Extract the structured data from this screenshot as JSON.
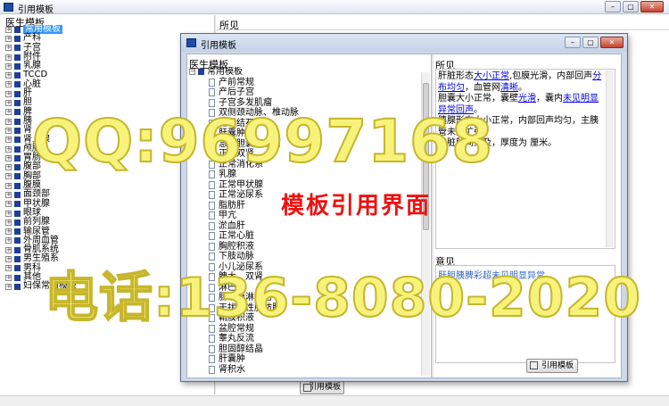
{
  "window": {
    "title": "引用模板",
    "buttons": [
      "–",
      "▢",
      "✕"
    ]
  },
  "left_tree": {
    "label": "医生模板",
    "items": [
      {
        "label": "常用模板",
        "selected": true
      },
      {
        "label": "产科"
      },
      {
        "label": "子宫"
      },
      {
        "label": "附件"
      },
      {
        "label": "乳腺"
      },
      {
        "label": "TCCD"
      },
      {
        "label": "心脏"
      },
      {
        "label": "肝"
      },
      {
        "label": "胆"
      },
      {
        "label": "脾"
      },
      {
        "label": "胰"
      },
      {
        "label": "肾"
      },
      {
        "label": "肾上腺"
      },
      {
        "label": "颅脑"
      },
      {
        "label": "胃肠"
      },
      {
        "label": "腹部"
      },
      {
        "label": "胸部"
      },
      {
        "label": "腹膜"
      },
      {
        "label": "面颈部"
      },
      {
        "label": "甲状腺"
      },
      {
        "label": "眼球"
      },
      {
        "label": "前列腺"
      },
      {
        "label": "输尿管"
      },
      {
        "label": "外周血管"
      },
      {
        "label": "骨肌系统"
      },
      {
        "label": "男生殖系"
      },
      {
        "label": "男科"
      },
      {
        "label": "其他"
      },
      {
        "label": "妇保常用模板"
      }
    ]
  },
  "main": {
    "findings_label": "所见",
    "use_template_button": "引用模板"
  },
  "dialog": {
    "title": "引用模板",
    "tree_label": "医生模板",
    "root": "常用模板",
    "children": [
      "产前常规",
      "产后子宫",
      "子宫多发肌瘤",
      "双侧颈动脉、椎动脉",
      "胆囊结石",
      "肝囊肿",
      "急性胆囊炎结石",
      "正常双肾",
      "正常消化系",
      "乳腺",
      "正常甲状腺",
      "正常泌尿系",
      "脂肪肝",
      "甲亢",
      "淤血肝",
      "正常心脏",
      "胸腔积液",
      "下肢动脉",
      "小儿泌尿系",
      "脾大、双肾",
      "淋巴结",
      "肠系膜淋巴结",
      "干扰质性脂肪肝",
      "鞘膜积液",
      "盆腔常规",
      "睾丸反流",
      "胆固醇结晶",
      "肝囊肿",
      "肾积水"
    ],
    "findings_label": "所见",
    "findings": [
      [
        {
          "t": "肝脏形态"
        },
        {
          "t": "大小正常",
          "link": true
        },
        {
          "t": ",包膜光滑，内部回声"
        },
        {
          "t": "分布均匀",
          "link": true
        },
        {
          "t": "，血管网"
        },
        {
          "t": "清晰",
          "link": true
        },
        {
          "t": "。"
        }
      ],
      [
        {
          "t": "胆囊大小正常，囊壁"
        },
        {
          "t": "光滑",
          "link": true
        },
        {
          "t": "，囊内"
        },
        {
          "t": "未见明显异常回声",
          "link": true
        },
        {
          "t": "。"
        }
      ],
      [
        {
          "t": "胰腺形态大小正常，内部回声均匀，主胰管未见扩张。"
        }
      ],
      [
        {
          "t": "脾脏肋间探及，厚度为 厘米。"
        }
      ]
    ],
    "opinion_label": "意见",
    "opinion": "肝胆胰脾彩超未见明显异常",
    "use_template_button": "引用模板"
  },
  "watermarks": {
    "qq": "QQ:96997168",
    "center": "模板引用界面",
    "phone": "电话:136-8080-2020"
  }
}
